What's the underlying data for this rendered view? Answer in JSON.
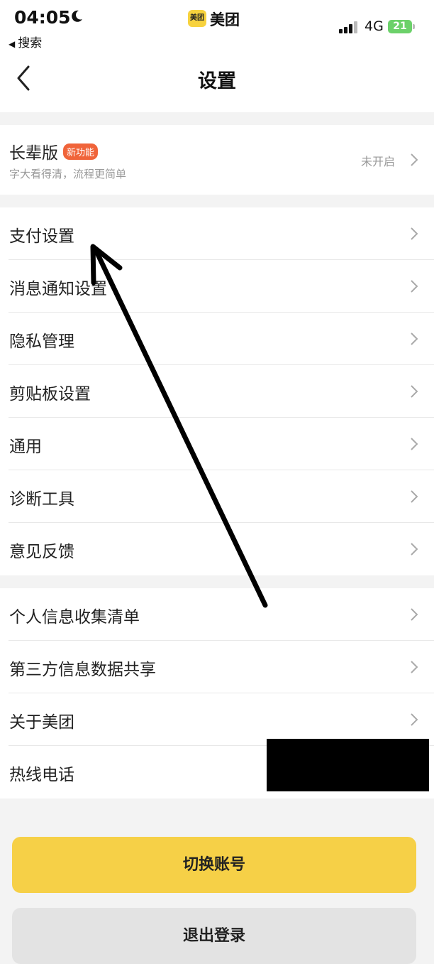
{
  "status_bar": {
    "time": "04:05",
    "back_app": "搜索",
    "app_logo": "美团",
    "app_name": "美团",
    "network": "4G",
    "battery": "21"
  },
  "nav": {
    "title": "设置",
    "back_icon": "chevron-left-icon"
  },
  "elder_mode": {
    "label": "长辈版",
    "badge": "新功能",
    "description": "字大看得清，流程更简单",
    "status": "未开启"
  },
  "settings_group_1": [
    {
      "label": "支付设置"
    },
    {
      "label": "消息通知设置"
    },
    {
      "label": "隐私管理"
    },
    {
      "label": "剪贴板设置"
    },
    {
      "label": "通用"
    },
    {
      "label": "诊断工具"
    },
    {
      "label": "意见反馈"
    }
  ],
  "settings_group_2": [
    {
      "label": "个人信息收集清单"
    },
    {
      "label": "第三方信息数据共享"
    },
    {
      "label": "关于美团"
    },
    {
      "label": "热线电话"
    }
  ],
  "buttons": {
    "switch_account": "切换账号",
    "logout": "退出登录"
  },
  "colors": {
    "accent_yellow": "#f6d047",
    "badge_orange": "#f0643a",
    "battery_green": "#6cd16a"
  }
}
